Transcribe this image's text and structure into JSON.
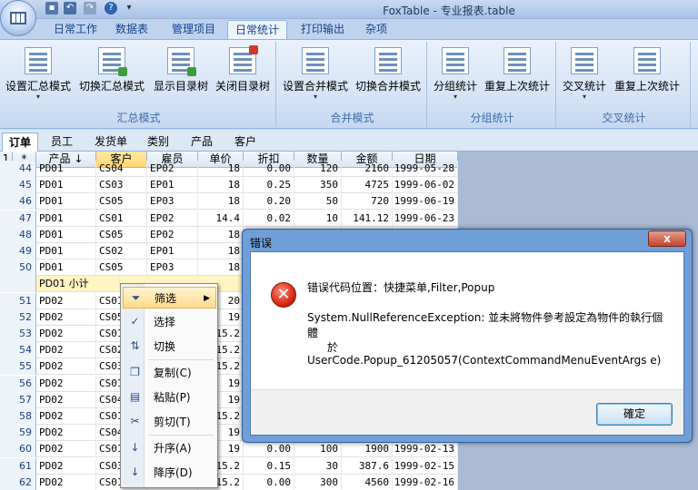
{
  "app": {
    "title": "FoxTable - 专业报表.table"
  },
  "quick_access": [
    "save-icon",
    "undo-icon",
    "redo-icon",
    "help-icon"
  ],
  "ribbon_tabs": [
    "日常工作",
    "数据表",
    "管理项目",
    "日常统计",
    "打印输出",
    "杂项"
  ],
  "ribbon_active_tab": "日常统计",
  "ribbon": {
    "groups": [
      {
        "label": "汇总模式",
        "buttons": [
          "设置汇总模式",
          "切换汇总模式",
          "显示目录树",
          "关闭目录树"
        ]
      },
      {
        "label": "合并模式",
        "buttons": [
          "设置合并模式",
          "切换合并模式"
        ]
      },
      {
        "label": "分组统计",
        "buttons": [
          "分组统计",
          "重复上次统计"
        ]
      },
      {
        "label": "交叉统计",
        "buttons": [
          "交叉统计",
          "重复上次统计"
        ]
      }
    ]
  },
  "sheet_tabs": [
    "订单",
    "员工",
    "发货单",
    "类别",
    "产品",
    "客户"
  ],
  "sheet_active": "订单",
  "grid": {
    "corner": [
      "1",
      "*"
    ],
    "columns": [
      "产品",
      "客户",
      "雇员",
      "单价",
      "折扣",
      "数量",
      "金额",
      "日期"
    ],
    "sort_indicator": "↓",
    "rows": [
      {
        "n": "44",
        "c": [
          "PD01",
          "CS04",
          "EP02",
          "18",
          "0.00",
          "120",
          "2160",
          "1999-05-28"
        ]
      },
      {
        "n": "45",
        "c": [
          "PD01",
          "CS03",
          "EP01",
          "18",
          "0.25",
          "350",
          "4725",
          "1999-06-02"
        ]
      },
      {
        "n": "46",
        "c": [
          "PD01",
          "CS05",
          "EP03",
          "18",
          "0.20",
          "50",
          "720",
          "1999-06-19"
        ]
      },
      {
        "n": "47",
        "c": [
          "PD01",
          "CS01",
          "EP02",
          "14.4",
          "0.02",
          "10",
          "141.12",
          "1999-06-23"
        ]
      },
      {
        "n": "48",
        "c": [
          "PD01",
          "CS05",
          "EP02",
          "18",
          "",
          "",
          "",
          ""
        ]
      },
      {
        "n": "49",
        "c": [
          "PD01",
          "CS02",
          "EP01",
          "18",
          "",
          "",
          "",
          ""
        ]
      },
      {
        "n": "50",
        "c": [
          "PD01",
          "CS05",
          "EP03",
          "18",
          "",
          "",
          "",
          ""
        ]
      },
      {
        "n": "",
        "sub": "PD01 小计",
        "c": [
          "",
          "",
          "",
          "",
          "",
          "",
          "",
          ""
        ]
      },
      {
        "n": "51",
        "c": [
          "PD02",
          "CS01",
          "",
          "20",
          "",
          "",
          "",
          ""
        ]
      },
      {
        "n": "52",
        "c": [
          "PD02",
          "CS05",
          "",
          "19",
          "",
          "",
          "",
          ""
        ]
      },
      {
        "n": "53",
        "c": [
          "PD02",
          "CS01",
          "",
          "15.2",
          "",
          "",
          "",
          ""
        ]
      },
      {
        "n": "54",
        "c": [
          "PD02",
          "CS02",
          "",
          "15.2",
          "",
          "",
          "",
          ""
        ]
      },
      {
        "n": "55",
        "c": [
          "PD02",
          "CS03",
          "",
          "15.2",
          "",
          "",
          "",
          ""
        ]
      },
      {
        "n": "56",
        "c": [
          "PD02",
          "CS01",
          "",
          "19",
          "",
          "",
          "",
          ""
        ]
      },
      {
        "n": "57",
        "c": [
          "PD02",
          "CS04",
          "",
          "19",
          "",
          "",
          "",
          ""
        ]
      },
      {
        "n": "58",
        "c": [
          "PD02",
          "CS01",
          "",
          "15.2",
          "",
          "",
          "",
          ""
        ]
      },
      {
        "n": "59",
        "c": [
          "PD02",
          "CS04",
          "",
          "19",
          "",
          "",
          "",
          ""
        ]
      },
      {
        "n": "60",
        "c": [
          "PD02",
          "CS01",
          "",
          "19",
          "0.00",
          "100",
          "1900",
          "1999-02-13"
        ]
      },
      {
        "n": "61",
        "c": [
          "PD02",
          "CS03",
          "",
          "15.2",
          "0.15",
          "30",
          "387.6",
          "1999-02-15"
        ]
      },
      {
        "n": "62",
        "c": [
          "PD02",
          "CS01",
          "",
          "15.2",
          "0.00",
          "300",
          "4560",
          "1999-02-16"
        ]
      }
    ]
  },
  "context_menu": [
    {
      "label": "筛选",
      "icon": "funnel-icon",
      "submenu": true,
      "highlighted": true
    },
    {
      "label": "选择",
      "icon": "select-icon"
    },
    {
      "label": "切换",
      "icon": "toggle-sort-icon"
    },
    {
      "label": "复制(C)",
      "icon": "copy-icon"
    },
    {
      "label": "粘贴(P)",
      "icon": "paste-icon"
    },
    {
      "label": "剪切(T)",
      "icon": "cut-icon"
    },
    {
      "label": "升序(A)",
      "icon": "sort-asc-icon"
    },
    {
      "label": "降序(D)",
      "icon": "sort-desc-icon"
    }
  ],
  "dialog": {
    "title": "错误",
    "close": "x",
    "icon": "error-icon",
    "line1": "错误代码位置：快捷菜单,Filter,Popup",
    "line2": "System.NullReferenceException: 並未將物件參考設定為物件的執行個",
    "line3": "體",
    "line4": "於",
    "line5": "UserCode.Popup_61205057(ContextCommandMenuEventArgs e)",
    "ok": "確定"
  }
}
